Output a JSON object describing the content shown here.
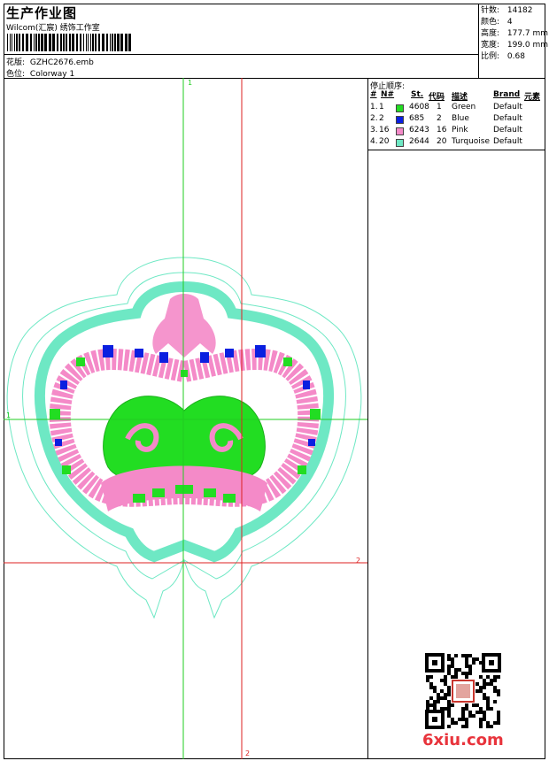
{
  "header": {
    "title": "生产作业图",
    "company": "Wilcom(汇宸) 绣饰工作室",
    "design_label": "花版:",
    "design_value": "GZHC2676.emb",
    "colorway_label": "色位:",
    "colorway_value": "Colorway 1"
  },
  "stats": [
    {
      "label": "针数:",
      "value": "14182"
    },
    {
      "label": "颜色:",
      "value": "4"
    },
    {
      "label": "高度:",
      "value": "177.7 mm"
    },
    {
      "label": "宽度:",
      "value": "199.0 mm"
    },
    {
      "label": "比例:",
      "value": "0.68"
    }
  ],
  "color_table": {
    "title": "停止顺序:",
    "columns": {
      "idx": "#",
      "no": "N#",
      "st": "St.",
      "code": "代码",
      "desc": "描述",
      "brand": "Brand",
      "extra": "元素"
    },
    "rows": [
      {
        "idx": "1.",
        "no": "1",
        "st": "4608",
        "code": "1",
        "desc": "Green",
        "brand": "Default",
        "color": "#22dd22"
      },
      {
        "idx": "2.",
        "no": "2",
        "st": "685",
        "code": "2",
        "desc": "Blue",
        "brand": "Default",
        "color": "#0a1fe0"
      },
      {
        "idx": "3.",
        "no": "16",
        "st": "6243",
        "code": "16",
        "desc": "Pink",
        "brand": "Default",
        "color": "#f48ac8"
      },
      {
        "idx": "4.",
        "no": "20",
        "st": "2644",
        "code": "20",
        "desc": "Turquoise",
        "brand": "Default",
        "color": "#6ee8c4"
      }
    ]
  },
  "axes": {
    "v1": "1",
    "h1": "1",
    "h2": "2",
    "v2": "2",
    "green": "#22cc22",
    "red": "#dd2222"
  },
  "footer": {
    "brand": "6xiu.com",
    "qr_icon": "qr-code-icon",
    "stamp_icon": "seal-stamp-icon"
  }
}
